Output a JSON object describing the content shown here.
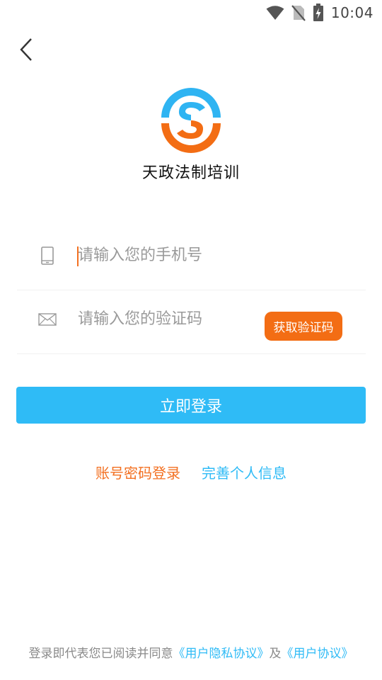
{
  "status_bar": {
    "time": "10:04",
    "icons": [
      "wifi-icon",
      "no-sim-icon",
      "battery-charging-icon"
    ]
  },
  "header": {
    "back_icon": "chevron-left-icon"
  },
  "brand": {
    "name": "天政法制培训",
    "logo_colors": {
      "blue": "#2fb4f2",
      "orange": "#f36d14"
    }
  },
  "form": {
    "phone": {
      "icon": "phone-icon",
      "placeholder": "请输入您的手机号",
      "value": ""
    },
    "code": {
      "icon": "mail-icon",
      "placeholder": "请输入您的验证码",
      "value": "",
      "button_label": "获取验证码"
    },
    "submit_label": "立即登录"
  },
  "links": {
    "password_login": "账号密码登录",
    "complete_profile": "完善个人信息"
  },
  "agreement": {
    "prefix": "登录即代表您已阅读并同意",
    "privacy_link": "《用户隐私协议》",
    "conjunction": "及",
    "terms_link": "《用户协议》"
  },
  "colors": {
    "accent_blue": "#2fbbf6",
    "accent_orange": "#f37021"
  }
}
